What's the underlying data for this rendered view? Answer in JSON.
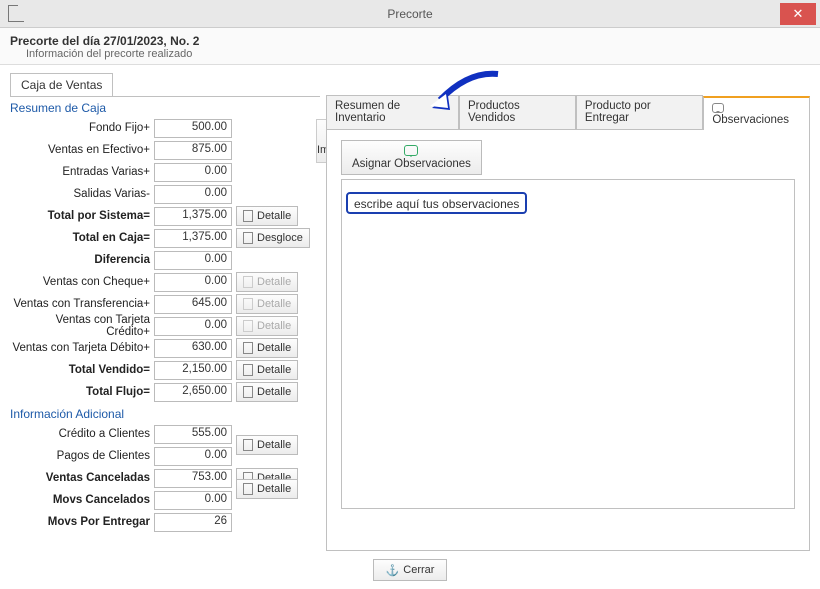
{
  "window": {
    "title": "Precorte",
    "close_aria": "Cerrar ventana"
  },
  "header": {
    "title": "Precorte del día 27/01/2023, No. 2",
    "subtitle": "Información del precorte realizado"
  },
  "left": {
    "tab_label": "Caja de Ventas",
    "section1_title": "Resumen de Caja",
    "section2_title": "Información Adicional",
    "print_label": "Imprimir",
    "detail_label": "Detalle",
    "desgloce_label": "Desgloce",
    "rows1": [
      {
        "label": "Fondo Fijo+",
        "value": "500.00",
        "bold": false,
        "btn": null
      },
      {
        "label": "Ventas en Efectivo+",
        "value": "875.00",
        "bold": false,
        "btn": null
      },
      {
        "label": "Entradas Varias+",
        "value": "0.00",
        "bold": false,
        "btn": null
      },
      {
        "label": "Salidas Varias-",
        "value": "0.00",
        "bold": false,
        "btn": null
      },
      {
        "label": "Total por Sistema=",
        "value": "1,375.00",
        "bold": true,
        "btn": "detail"
      },
      {
        "label": "Total en Caja=",
        "value": "1,375.00",
        "bold": true,
        "btn": "desgloce"
      },
      {
        "label": "Diferencia",
        "value": "0.00",
        "bold": true,
        "btn": null
      },
      {
        "label": "Ventas con Cheque+",
        "value": "0.00",
        "bold": false,
        "btn": "detail-disabled"
      },
      {
        "label": "Ventas con Transferencia+",
        "value": "645.00",
        "bold": false,
        "btn": "detail-disabled"
      },
      {
        "label": "Ventas con Tarjeta Crédito+",
        "value": "0.00",
        "bold": false,
        "btn": "detail-disabled"
      },
      {
        "label": "Ventas con Tarjeta Débito+",
        "value": "630.00",
        "bold": false,
        "btn": "detail"
      },
      {
        "label": "Total Vendido=",
        "value": "2,150.00",
        "bold": true,
        "btn": "detail"
      },
      {
        "label": "Total Flujo=",
        "value": "2,650.00",
        "bold": true,
        "btn": "detail"
      }
    ],
    "rows2": [
      {
        "label": "Crédito a Clientes",
        "value": "555.00",
        "bold": false,
        "btn": null
      },
      {
        "label": "Pagos de Clientes",
        "value": "0.00",
        "bold": false,
        "btn": "detail-shared"
      },
      {
        "label": "Ventas Canceladas",
        "value": "753.00",
        "bold": true,
        "btn": "detail"
      },
      {
        "label": "Movs Cancelados",
        "value": "0.00",
        "bold": true,
        "btn": "detail-shared"
      },
      {
        "label": "Movs Por Entregar",
        "value": "26",
        "bold": true,
        "btn": null
      }
    ]
  },
  "right": {
    "tabs": [
      "Resumen de Inventario",
      "Productos Vendidos",
      "Producto por Entregar",
      "Observaciones"
    ],
    "active_tab": 3,
    "assign_label": "Asignar Observaciones",
    "obs_placeholder": "escribe aquí tus observaciones"
  },
  "footer": {
    "close_label": "Cerrar"
  }
}
